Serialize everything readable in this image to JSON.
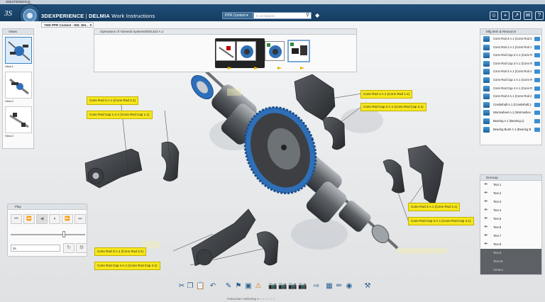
{
  "window": {
    "title": "3DEXPERIENCE"
  },
  "appbar": {
    "brand": "3DEXPERIENCE",
    "separator": " | ",
    "app_brand": "DELMIA",
    "app_name": " Work Instructions",
    "context_label": "PPR Context",
    "search_placeholder": "In 12 Spaces"
  },
  "tab": {
    "label": "YMS PPR Context - INS_W3..."
  },
  "views_panel": {
    "title": "Views",
    "items": [
      {
        "label": "View.1"
      },
      {
        "label": "View.2"
      },
      {
        "label": "View.3"
      }
    ]
  },
  "operations_panel": {
    "title": "Operations of 'General System00001322 A.1'"
  },
  "callouts": {
    "c1": "Conn Rod 2 A.1 (Conn Rod 2.1)",
    "c2": "Conn Rod Cap 1 A.1 (Conn Rod Cap 1.1)",
    "c3": "Conn Rod 1 A.1 (Conn Rod 1.1)",
    "c4": "Conn Rod Cap 2 A.1 (Conn Rod Cap 2.1)",
    "c5": "Conn Rod 4 A.1 (Conn Rod 4.1)",
    "c6": "Conn Rod Cap 3 A.1 (Conn Rod Cap 3.1)",
    "c7": "Conn Rod 3 A.1 (Conn Rod 3.1)",
    "c8": "Conn Rod Cap 4 A.1 (Conn Rod Cap 4.1)"
  },
  "mfg_panel": {
    "title": "Mfg Item & Resource",
    "items": [
      {
        "label": "Conn Rod 3 A.1 (Conn Rod 3"
      },
      {
        "label": "Conn Rod 1 A.1 (Conn Rod 1"
      },
      {
        "label": "Conn Rod Cap 2 A.1 (Conn R"
      },
      {
        "label": "Conn Rod Cap 3 A.1 (Conn R"
      },
      {
        "label": "Conn Rod 4 A.1 (Conn Rod 4"
      },
      {
        "label": "Conn Rod Cap 1 A.1 (Conn R"
      },
      {
        "label": "Conn Rod Cap 4 A.1 (Conn R"
      },
      {
        "label": "Conn Rod 2 A.1 (Conn Rod 2"
      },
      {
        "label": "Crankshaft A.1 (Crankshaft.1"
      },
      {
        "label": "Wormwheel A.1 (Wormwhee"
      },
      {
        "label": "Bearing A.1 (Bearing.1)"
      },
      {
        "label": "Bearing Bush A.1 (Bearing B"
      }
    ]
  },
  "dress_panel": {
    "title": "Dressup",
    "items": [
      {
        "label": "Text.1"
      },
      {
        "label": "Text.2"
      },
      {
        "label": "Text.3"
      },
      {
        "label": "Text.4"
      },
      {
        "label": "Text.5"
      },
      {
        "label": "Text.6"
      },
      {
        "label": "Text.7"
      },
      {
        "label": "Text.8"
      },
      {
        "label": "Text.9"
      },
      {
        "label": "Text.10"
      },
      {
        "label": "Arrow.1"
      }
    ]
  },
  "play_panel": {
    "title": "Play",
    "speed_value": "2s"
  },
  "status": {
    "text": "Instruction Authoring"
  },
  "colors": {
    "accent": "#1f4e79",
    "callout": "#f7e71d",
    "gear": "#2f6fb7"
  }
}
